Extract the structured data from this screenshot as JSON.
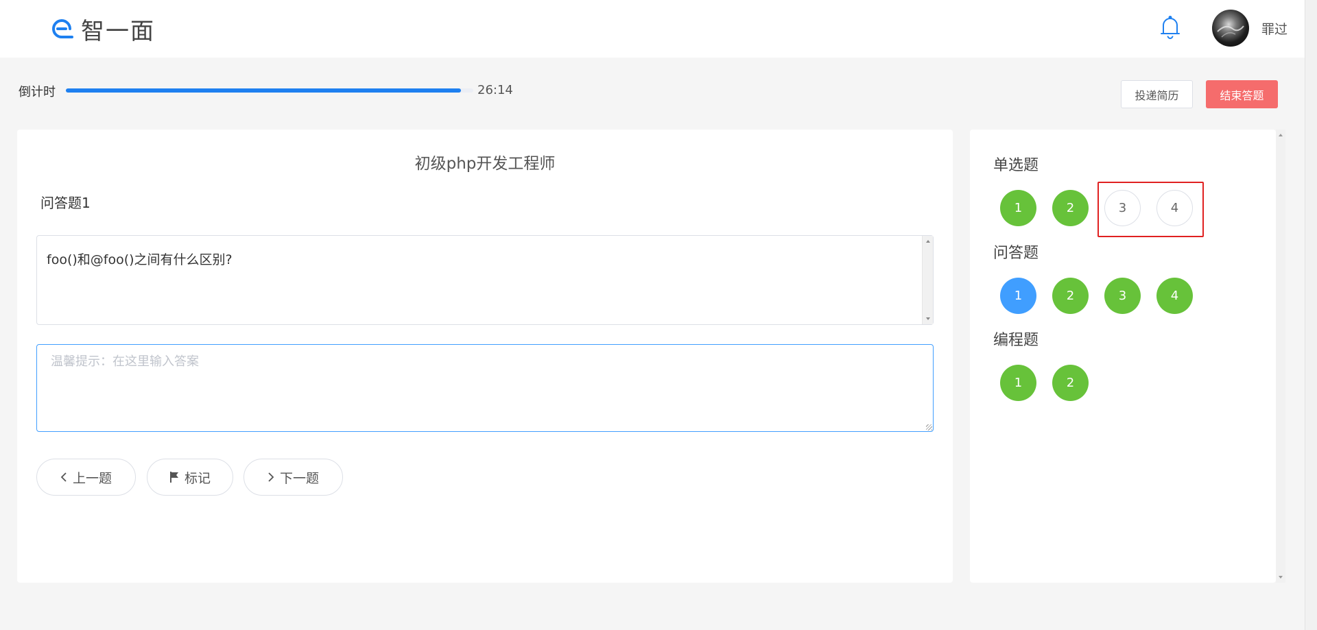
{
  "header": {
    "logo_text": "智一面",
    "username": "罪过"
  },
  "countdown": {
    "label": "倒计时",
    "time": "26:14",
    "progress_fraction": 0.97
  },
  "actions": {
    "resume_label": "投递简历",
    "end_label": "结束答题"
  },
  "question": {
    "exam_title": "初级php开发工程师",
    "title": "问答题1",
    "text": "foo()和@foo()之间有什么区别?",
    "answer_placeholder": "温馨提示：在这里输入答案",
    "answer_value": ""
  },
  "nav": {
    "prev_label": "上一题",
    "mark_label": "标记",
    "next_label": "下一题"
  },
  "colors": {
    "done": "#67c23a",
    "current": "#409eff",
    "accent": "#1e80f0",
    "danger": "#f56c6c"
  },
  "sections": [
    {
      "title": "单选题",
      "items": [
        {
          "label": "1",
          "status": "done"
        },
        {
          "label": "2",
          "status": "done"
        },
        {
          "label": "3",
          "status": "empty"
        },
        {
          "label": "4",
          "status": "empty"
        }
      ]
    },
    {
      "title": "问答题",
      "items": [
        {
          "label": "1",
          "status": "current"
        },
        {
          "label": "2",
          "status": "done"
        },
        {
          "label": "3",
          "status": "done"
        },
        {
          "label": "4",
          "status": "done"
        }
      ]
    },
    {
      "title": "编程题",
      "items": [
        {
          "label": "1",
          "status": "done"
        },
        {
          "label": "2",
          "status": "done"
        }
      ]
    }
  ]
}
